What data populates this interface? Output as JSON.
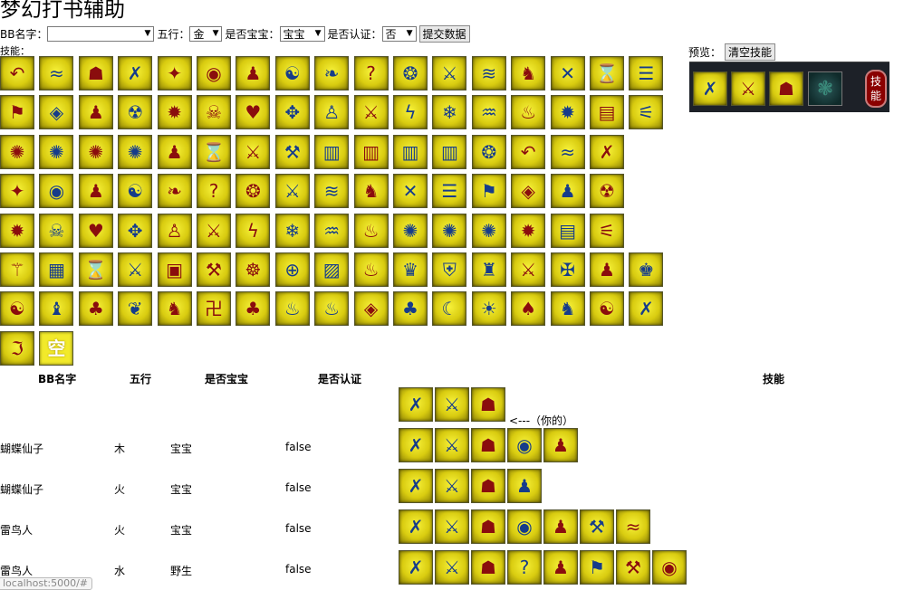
{
  "title": "梦幻打书辅助",
  "form": {
    "bb_name_label": "BB名字：",
    "bb_name_value": "",
    "wuxing_label": "五行：",
    "wuxing_value": "金",
    "baobao_label": "是否宝宝：",
    "baobao_value": "宝宝",
    "renzheng_label": "是否认证：",
    "renzheng_value": "否",
    "submit_label": "提交数据",
    "dropdown_arrow": "▼"
  },
  "skills_label": "技能：",
  "skill_grid": [
    [
      "↶",
      "≈",
      "☗",
      "✗",
      "✦",
      "◉",
      "♟",
      "☯",
      "❧",
      "?",
      "❂",
      "⚔",
      "≋",
      "♞",
      "✕",
      "⌛",
      "☰"
    ],
    [
      "⚑",
      "◈",
      "♟",
      "☢",
      "✹",
      "☠",
      "♥",
      "✥",
      "♙",
      "⚔",
      "ϟ",
      "❄",
      "♒",
      "♨",
      "✹",
      "▤",
      "⚟"
    ],
    [
      "✺",
      "✺",
      "✺",
      "✺",
      "♟",
      "⌛",
      "⚔",
      "⚒",
      "▥",
      "▥",
      "▥",
      "▥",
      "❂",
      "↶",
      "≈",
      "✗"
    ],
    [
      "✦",
      "◉",
      "♟",
      "☯",
      "❧",
      "?",
      "❂",
      "⚔",
      "≋",
      "♞",
      "✕",
      "☰",
      "⚑",
      "◈",
      "♟",
      "☢"
    ],
    [
      "✹",
      "☠",
      "♥",
      "✥",
      "♙",
      "⚔",
      "ϟ",
      "❄",
      "♒",
      "♨",
      "✺",
      "✺",
      "✺",
      "✹",
      "▤",
      "⚟"
    ],
    [
      "⚚",
      "▦",
      "⌛",
      "⚔",
      "▣",
      "⚒",
      "☸",
      "⊕",
      "▨",
      "♨",
      "♛",
      "⛨",
      "♜",
      "⚔",
      "✠",
      "♟",
      "♚"
    ],
    [
      "☯",
      "♝",
      "♣",
      "❦",
      "♞",
      "卍",
      "♣",
      "♨",
      "♨",
      "◈",
      "♣",
      "☾",
      "☀",
      "♠",
      "♞",
      "☯",
      "✗"
    ]
  ],
  "skill_grid_extra": [
    "ℑ",
    "空"
  ],
  "preview": {
    "label": "预览：",
    "clear_label": "清空技能",
    "slots": [
      "✗",
      "⚔",
      "☗"
    ],
    "empty_slot_icon": "❃",
    "badge_line1": "技",
    "badge_line2": "能"
  },
  "table": {
    "headers": [
      "BB名字",
      "五行",
      "是否宝宝",
      "是否认证",
      "技能"
    ],
    "you_label": "<---（你的）",
    "my_row_icons": [
      "✗",
      "⚔",
      "☗"
    ],
    "rows": [
      {
        "name": "蝴蝶仙子",
        "wuxing": "木",
        "baobao": "宝宝",
        "renzheng": "false",
        "icons": [
          "✗",
          "⚔",
          "☗",
          "◉",
          "♟"
        ]
      },
      {
        "name": "蝴蝶仙子",
        "wuxing": "火",
        "baobao": "宝宝",
        "renzheng": "false",
        "icons": [
          "✗",
          "⚔",
          "☗",
          "♟"
        ]
      },
      {
        "name": "雷鸟人",
        "wuxing": "火",
        "baobao": "宝宝",
        "renzheng": "false",
        "icons": [
          "✗",
          "⚔",
          "☗",
          "◉",
          "♟",
          "⚒",
          "≈"
        ]
      },
      {
        "name": "雷鸟人",
        "wuxing": "水",
        "baobao": "野生",
        "renzheng": "false",
        "icons": [
          "✗",
          "⚔",
          "☗",
          "?",
          "♟",
          "⚑",
          "⚒",
          "◉"
        ]
      }
    ]
  },
  "status_url": "localhost:5000/#"
}
